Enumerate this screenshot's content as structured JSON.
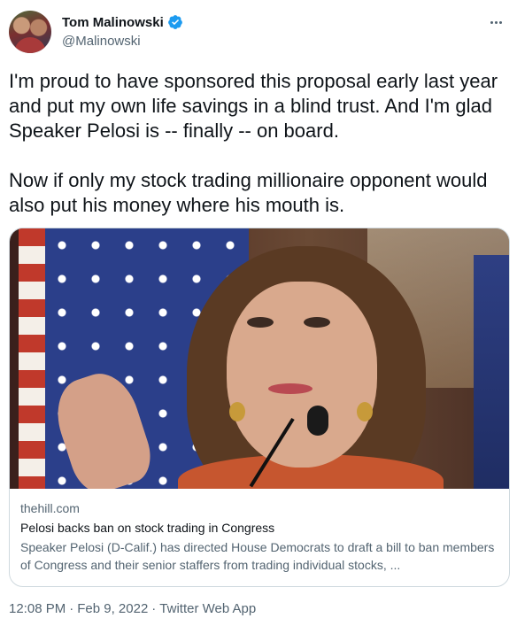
{
  "author": {
    "display_name": "Tom Malinowski",
    "handle": "@Malinowski",
    "verified": true,
    "verified_icon": "verified-badge-icon",
    "avatar_icon": "avatar"
  },
  "tweet": {
    "text": "I'm proud to have sponsored this proposal early last year and put my own life savings in a blind trust. And I'm glad Speaker Pelosi is -- finally -- on board.\n\nNow if only my stock trading millionaire opponent would also put his money where his mouth is."
  },
  "card": {
    "domain": "thehill.com",
    "title": "Pelosi backs ban on stock trading in Congress",
    "description": "Speaker Pelosi (D-Calif.) has directed House Democrats to draft a bill to ban members of Congress and their senior staffers from trading individual stocks, ..."
  },
  "footer": {
    "time": "12:08 PM",
    "separator": "·",
    "date": "Feb 9, 2022",
    "app": "Twitter Web App"
  },
  "colors": {
    "text_primary": "#0f1419",
    "text_secondary": "#536471",
    "verified_blue": "#1d9bf0",
    "border": "#cfd9de"
  }
}
